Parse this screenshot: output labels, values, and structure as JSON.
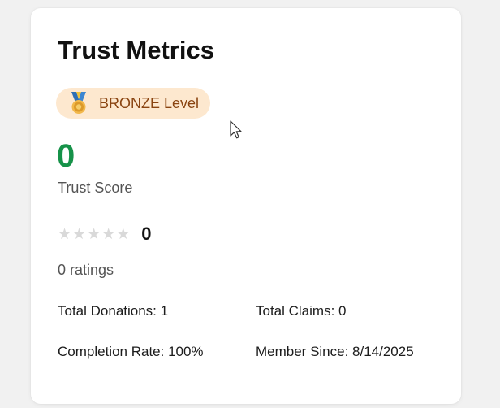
{
  "card": {
    "title": "Trust Metrics",
    "badge": {
      "icon": "medal-icon",
      "label": "BRONZE Level",
      "background": "#fde8cf",
      "text_color": "#8a4411"
    },
    "trust_score": {
      "value": "0",
      "label": "Trust Score",
      "color": "#169249"
    },
    "rating": {
      "stars_filled": 0,
      "stars_total": 5,
      "value": "0",
      "count_label": "0 ratings"
    },
    "stats": [
      {
        "text": "Total Donations: 1"
      },
      {
        "text": "Total Claims: 0"
      },
      {
        "text": "Completion Rate: 100%"
      },
      {
        "text": "Member Since: 8/14/2025"
      }
    ]
  }
}
